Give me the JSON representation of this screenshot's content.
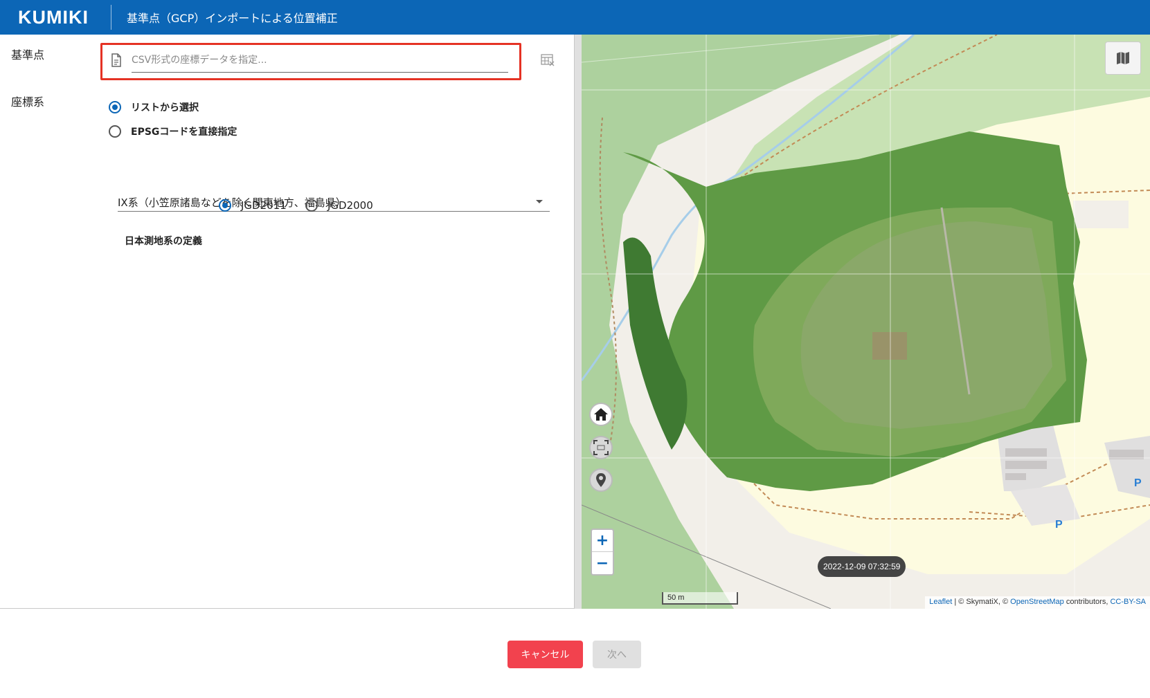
{
  "header": {
    "logo": "KUMIKI",
    "title": "基準点（GCP）インポートによる位置補正"
  },
  "form": {
    "gcp_label": "基準点",
    "file_placeholder": "CSV形式の座標データを指定...",
    "crs_label": "座標系",
    "crs_options": [
      {
        "label": "リストから選択",
        "selected": true
      },
      {
        "label": "EPSGコードを直接指定",
        "selected": false
      }
    ],
    "crs_select_value": "IX系（小笠原諸島などを除く関東地方、福島県）",
    "datum_label": "日本測地系の定義",
    "datum_options": [
      {
        "label": "JGD2011",
        "selected": true
      },
      {
        "label": "JGD2000",
        "selected": false
      }
    ]
  },
  "map": {
    "timestamp": "2022-12-09 07:32:59",
    "scale_label": "50 m",
    "zoom_in": "+",
    "zoom_out": "−",
    "parking_label": "P",
    "attribution": {
      "leaflet": "Leaflet",
      "sep": " | © SkymatiX, © ",
      "osm": "OpenStreetMap",
      "contrib": " contributors, ",
      "license": "CC-BY-SA"
    },
    "icons": [
      "layers-map-icon",
      "home-icon",
      "gcp-fit-icon",
      "marker-icon"
    ]
  },
  "actions": {
    "cancel": "キャンセル",
    "next": "次へ"
  },
  "colors": {
    "brand": "#0c66b6",
    "highlight_border": "#e53224",
    "cancel": "#f2424e"
  }
}
